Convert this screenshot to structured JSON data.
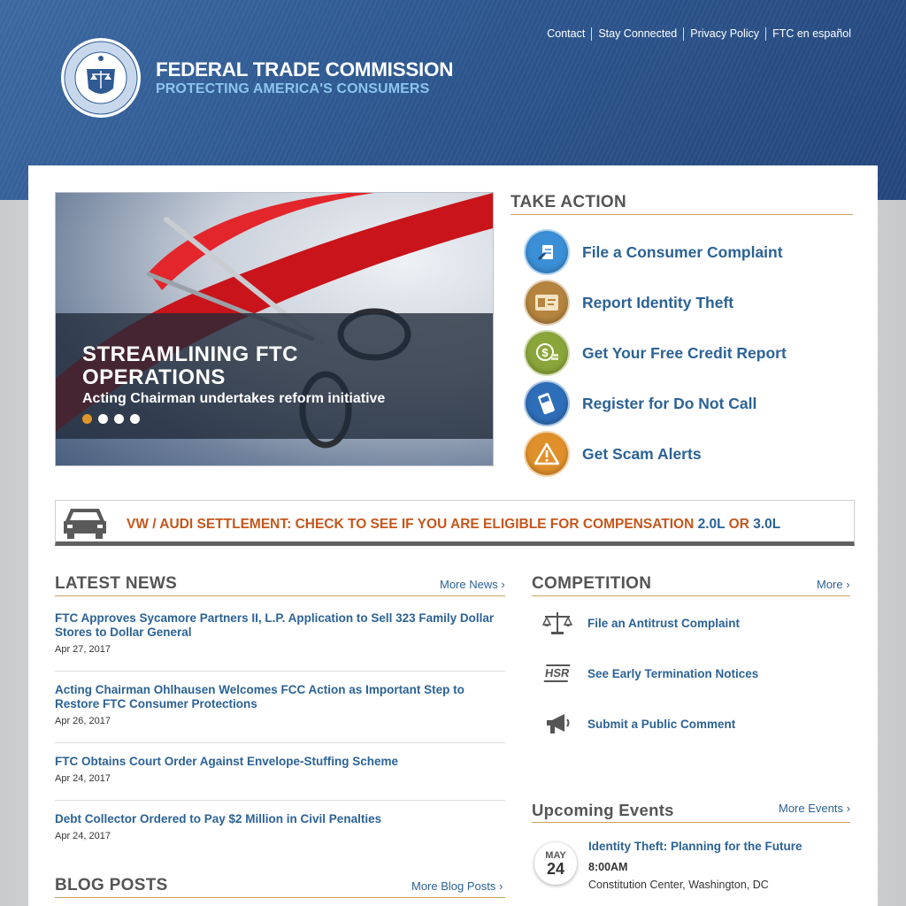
{
  "header": {
    "links": [
      "Contact",
      "Stay Connected",
      "Privacy Policy",
      "FTC en español"
    ],
    "agency_name": "FEDERAL TRADE COMMISSION",
    "tagline": "PROTECTING AMERICA'S CONSUMERS"
  },
  "hero": {
    "title": "STREAMLINING FTC OPERATIONS",
    "subtitle": "Acting Chairman undertakes reform initiative",
    "slides": 4,
    "active_slide": 1
  },
  "take_action": {
    "heading": "TAKE ACTION",
    "items": [
      {
        "label": "File a Consumer Complaint",
        "icon": "complaint-icon",
        "color": "#3b8fd6"
      },
      {
        "label": "Report Identity Theft",
        "icon": "id-card-icon",
        "color": "#b5843f"
      },
      {
        "label": "Get Your Free Credit Report",
        "icon": "money-icon",
        "color": "#8aa63a"
      },
      {
        "label": "Register for Do Not Call",
        "icon": "phone-icon",
        "color": "#2e6eb8"
      },
      {
        "label": "Get Scam Alerts",
        "icon": "warning-icon",
        "color": "#e0902a"
      }
    ]
  },
  "alert": {
    "text": "VW / AUDI SETTLEMENT: CHECK TO SEE IF YOU ARE ELIGIBLE FOR COMPENSATION",
    "link1": "2.0L",
    "or": "OR",
    "link2": "3.0L"
  },
  "latest_news": {
    "heading": "LATEST NEWS",
    "more": "More News ›",
    "items": [
      {
        "title": "FTC Approves Sycamore Partners II, L.P. Application to Sell 323 Family Dollar Stores to Dollar General",
        "date": "Apr 27, 2017"
      },
      {
        "title": "Acting Chairman Ohlhausen Welcomes FCC Action as Important Step to Restore FTC Consumer Protections",
        "date": "Apr 26, 2017"
      },
      {
        "title": "FTC Obtains Court Order Against Envelope-Stuffing Scheme",
        "date": "Apr 24, 2017"
      },
      {
        "title": "Debt Collector Ordered to Pay $2 Million in Civil Penalties",
        "date": "Apr 24, 2017"
      }
    ]
  },
  "competition": {
    "heading": "COMPETITION",
    "more": "More ›",
    "items": [
      {
        "label": "File an Antitrust Complaint",
        "icon": "scales-icon"
      },
      {
        "label": "See Early Termination Notices",
        "icon": "hsr-icon",
        "icon_text": "HSR"
      },
      {
        "label": "Submit a Public Comment",
        "icon": "megaphone-icon"
      }
    ]
  },
  "events": {
    "heading": "Upcoming Events",
    "more": "More Events ›",
    "items": [
      {
        "month": "MAY",
        "day": "24",
        "title": "Identity Theft: Planning for the Future",
        "time": "8:00AM",
        "location": "Constitution Center, Washington, DC"
      }
    ]
  },
  "blog": {
    "heading": "BLOG POSTS",
    "more": "More Blog Posts ›"
  }
}
